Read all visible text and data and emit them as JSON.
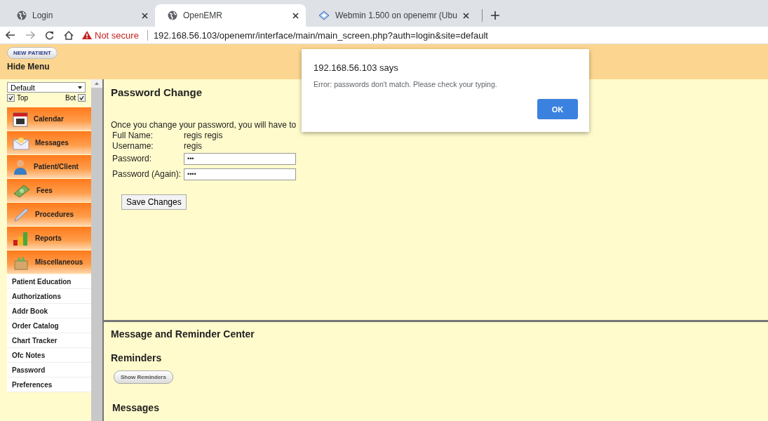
{
  "browser": {
    "tabs": [
      {
        "title": "Login",
        "selected": false
      },
      {
        "title": "OpenEMR",
        "selected": true
      },
      {
        "title": "Webmin 1.500 on openemr (Ubu",
        "selected": false
      }
    ],
    "security": "Not secure",
    "url": "192.168.56.103/openemr/interface/main/main_screen.php?auth=login&site=default"
  },
  "header": {
    "new_patient": "NEW PATIENT",
    "hide_menu": "Hide Menu"
  },
  "sidebar": {
    "layout_select": "Default",
    "toggles": [
      {
        "label": "Top",
        "checked": true
      },
      {
        "label": "Bot",
        "checked": true
      }
    ],
    "nav": [
      {
        "label": "Calendar"
      },
      {
        "label": "Messages"
      },
      {
        "label": "Patient/Client"
      },
      {
        "label": "Fees"
      },
      {
        "label": "Procedures"
      },
      {
        "label": "Reports"
      },
      {
        "label": "Miscellaneous"
      }
    ],
    "links": [
      "Patient Education",
      "Authorizations",
      "Addr Book",
      "Order Catalog",
      "Chart Tracker",
      "Ofc Notes",
      "Password",
      "Preferences"
    ]
  },
  "password_change": {
    "title": "Password Change",
    "intro": "Once you change your password, you will have to",
    "info": [
      {
        "label": "Full Name:",
        "value": "regis regis"
      },
      {
        "label": "Username:",
        "value": "regis"
      }
    ],
    "fields": [
      {
        "label": "Password:",
        "value": "•••"
      },
      {
        "label": "Password (Again):",
        "value": "••••"
      }
    ],
    "save": "Save Changes"
  },
  "reminder_center": {
    "title": "Message and Reminder Center",
    "reminders": "Reminders",
    "show_reminders": "Show Reminders",
    "messages": "Messages"
  },
  "dialog": {
    "title": "192.168.56.103 says",
    "message": "Error: passwords don't match. Please check your typing.",
    "ok": "OK"
  }
}
